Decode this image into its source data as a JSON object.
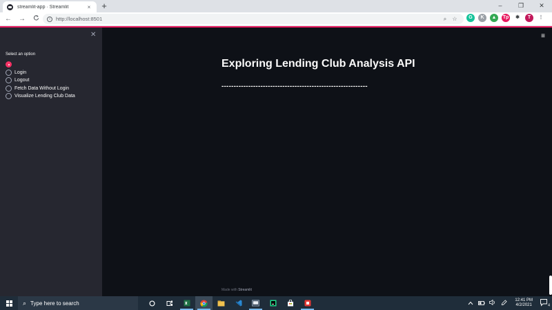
{
  "browser": {
    "tab_title": "streamlit-app · Streamlit",
    "tab_close": "×",
    "new_tab": "+",
    "minimize": "–",
    "maximize": "❐",
    "close": "✕",
    "back": "←",
    "forward": "→",
    "reload": "C",
    "url": "http://localhost:8501",
    "info_icon": "i",
    "zoom_icon": "⌕",
    "bookmark_icon": "☆",
    "extensions": [
      {
        "name": "grammarly-icon",
        "glyph": "G",
        "color": "#15c39a"
      },
      {
        "name": "k-extension-icon",
        "glyph": "K",
        "color": "#9aa0a6"
      },
      {
        "name": "google-drive-icon",
        "glyph": "▲",
        "color": "#34a853"
      },
      {
        "name": "tp-extension-icon",
        "glyph": "Tp",
        "color": "#e8175d"
      },
      {
        "name": "puzzle-icon",
        "glyph": "✱",
        "color": "#3c4043"
      },
      {
        "name": "profile-avatar",
        "glyph": "T",
        "color": "#c2185b"
      },
      {
        "name": "more-menu-icon",
        "glyph": "⋮",
        "color": "#5f6368"
      }
    ]
  },
  "sidebar": {
    "close_icon": "✕",
    "label": "Select an option",
    "options": [
      {
        "label": "",
        "selected": true
      },
      {
        "label": "Login",
        "selected": false
      },
      {
        "label": "Logout",
        "selected": false
      },
      {
        "label": "Fetch Data Without Login",
        "selected": false
      },
      {
        "label": "Visualize Lending Club Data",
        "selected": false
      }
    ]
  },
  "main": {
    "menu_icon": "≡",
    "title": "Exploring Lending Club Analysis API",
    "divider": "------------------------------------------------------------",
    "footer_prefix": "Made with ",
    "footer_brand": "Streamlit"
  },
  "taskbar": {
    "search_icon": "⌕",
    "search_placeholder": "Type here to search",
    "clock_time": "12:41 PM",
    "clock_date": "4/2/2021",
    "notification_badge": "4"
  },
  "colors": {
    "accent": "#f63366",
    "sidebar_bg": "#262730",
    "main_bg": "#0e1117",
    "taskbar_bg": "#1f2d3a"
  }
}
